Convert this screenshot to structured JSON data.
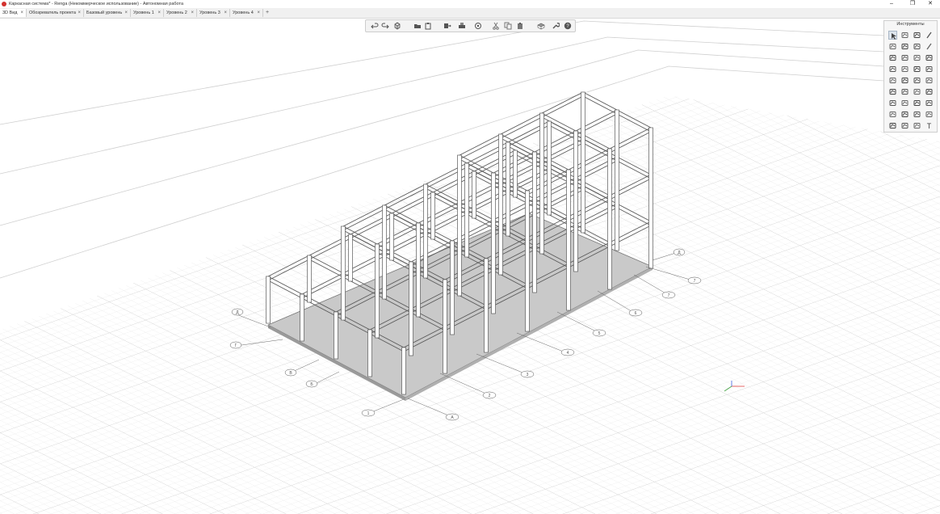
{
  "window": {
    "title": "Каркасная система* - Renga (Некоммерческое использование) - Автономная работа",
    "controls": [
      "–",
      "❐",
      "✕"
    ]
  },
  "tabs": [
    {
      "label": "3D Вид",
      "active": true
    },
    {
      "label": "Обозреватель проекта",
      "active": false
    },
    {
      "label": "Базовый уровень",
      "active": false
    },
    {
      "label": "Уровень 1",
      "active": false
    },
    {
      "label": "Уровень 2",
      "active": false
    },
    {
      "label": "Уровень 3",
      "active": false
    },
    {
      "label": "Уровень 4",
      "active": false
    }
  ],
  "tab_close": "×",
  "add_tab": "+",
  "toolbar": {
    "items": [
      "undo-icon",
      "redo-icon",
      "view-cube-icon",
      "folder-icon",
      "clipboard-icon",
      "export-icon",
      "print-icon",
      "orbit-icon",
      "cut-icon",
      "copy-icon",
      "paste-icon",
      "camera-icon",
      "wrench-icon",
      "help-icon"
    ]
  },
  "palette": {
    "title": "Инструменты",
    "tools": [
      "select-icon",
      "brush-icon",
      "corner-icon",
      "line-icon",
      "slab-icon",
      "beam-icon",
      "roof-icon",
      "pencil-icon",
      "stair-icon",
      "ramp-icon",
      "door-icon",
      "column-icon",
      "window-icon",
      "rail-icon",
      "sink-icon",
      "tap-icon",
      "equipment-icon",
      "cabinet-icon",
      "fixture-icon",
      "pipe-icon",
      "pump-icon",
      "fan-icon",
      "valve-icon",
      "duct-icon",
      "rebar-icon",
      "hook-icon",
      "mesh-icon",
      "assembly-icon",
      "opening-icon",
      "flange-icon",
      "door-leaf-icon",
      "hanger-icon",
      "dimension-icon",
      "level-icon",
      "elevation-icon",
      "text-icon"
    ]
  },
  "axes": {
    "numbers": [
      "1",
      "2",
      "3",
      "4",
      "5",
      "6",
      "7"
    ],
    "letters": [
      "А",
      "Б",
      "В",
      "Г",
      "Д"
    ]
  }
}
